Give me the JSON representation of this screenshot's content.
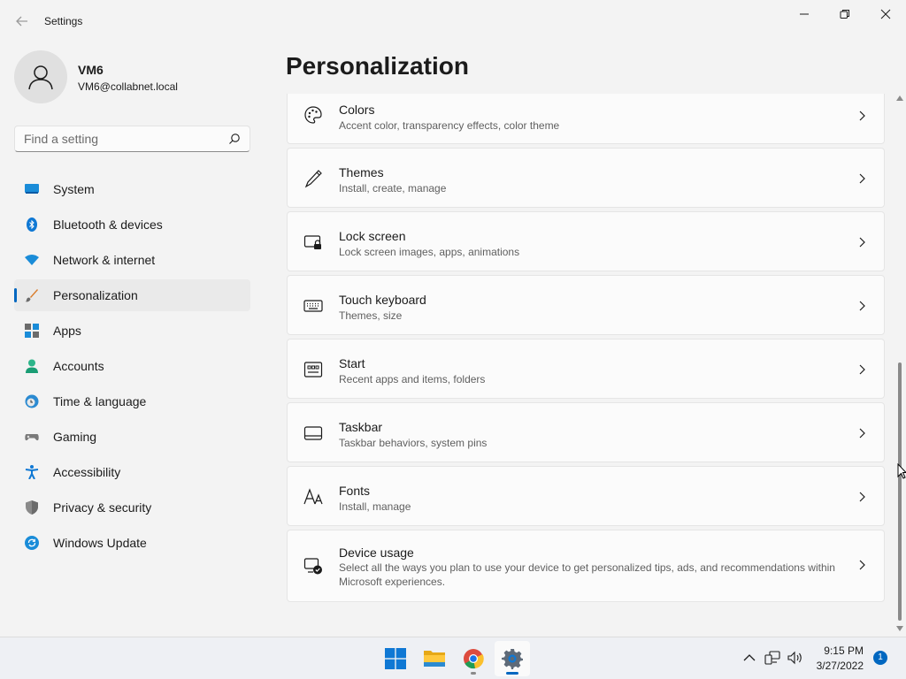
{
  "window": {
    "title": "Settings"
  },
  "profile": {
    "name": "VM6",
    "email": "VM6@collabnet.local"
  },
  "search": {
    "placeholder": "Find a setting"
  },
  "nav": [
    {
      "label": "System",
      "icon": "system-icon"
    },
    {
      "label": "Bluetooth & devices",
      "icon": "bluetooth-icon"
    },
    {
      "label": "Network & internet",
      "icon": "wifi-icon"
    },
    {
      "label": "Personalization",
      "icon": "brush-icon",
      "selected": true
    },
    {
      "label": "Apps",
      "icon": "apps-icon"
    },
    {
      "label": "Accounts",
      "icon": "accounts-icon"
    },
    {
      "label": "Time & language",
      "icon": "clock-globe-icon"
    },
    {
      "label": "Gaming",
      "icon": "gamepad-icon"
    },
    {
      "label": "Accessibility",
      "icon": "accessibility-icon"
    },
    {
      "label": "Privacy & security",
      "icon": "shield-icon"
    },
    {
      "label": "Windows Update",
      "icon": "update-icon"
    }
  ],
  "page": {
    "title": "Personalization"
  },
  "settings": [
    {
      "title": "Colors",
      "desc": "Accent color, transparency effects, color theme",
      "icon": "palette-icon"
    },
    {
      "title": "Themes",
      "desc": "Install, create, manage",
      "icon": "pen-icon"
    },
    {
      "title": "Lock screen",
      "desc": "Lock screen images, apps, animations",
      "icon": "lock-screen-icon"
    },
    {
      "title": "Touch keyboard",
      "desc": "Themes, size",
      "icon": "keyboard-icon"
    },
    {
      "title": "Start",
      "desc": "Recent apps and items, folders",
      "icon": "start-icon"
    },
    {
      "title": "Taskbar",
      "desc": "Taskbar behaviors, system pins",
      "icon": "taskbar-icon"
    },
    {
      "title": "Fonts",
      "desc": "Install, manage",
      "icon": "fonts-icon"
    },
    {
      "title": "Device usage",
      "desc": "Select all the ways you plan to use your device to get personalized tips, ads, and recommendations within Microsoft experiences.",
      "icon": "device-usage-icon"
    }
  ],
  "taskbar": {
    "apps": [
      "windows-start-icon",
      "file-explorer-icon",
      "chrome-icon",
      "settings-gear-icon"
    ],
    "time": "9:15 PM",
    "date": "3/27/2022",
    "notifications": "1"
  },
  "colors": {
    "accent": "#0067c0",
    "background": "#f3f3f3",
    "card": "#fbfbfb"
  }
}
